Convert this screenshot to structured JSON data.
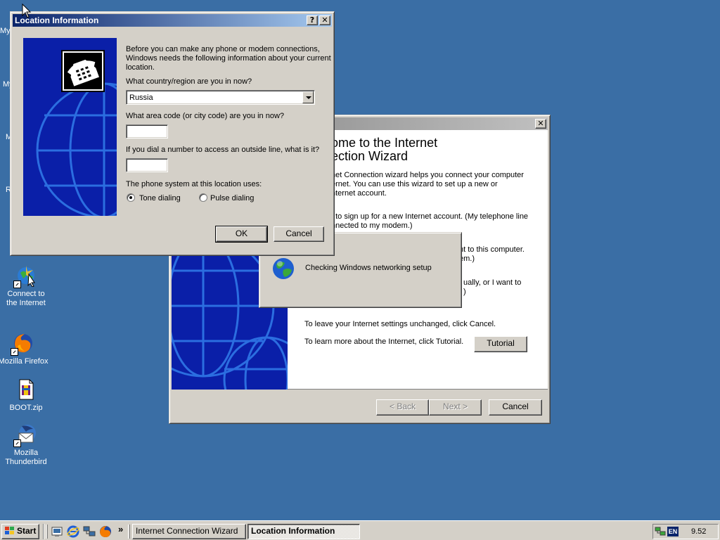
{
  "desktop": {
    "partial_labels": [
      "My",
      "My",
      "M",
      "R"
    ],
    "icons": [
      {
        "label_line1": "Connect to",
        "label_line2": "the Internet",
        "icon": "connect-internet-icon"
      },
      {
        "label_line1": "Mozilla Firefox",
        "label_line2": "",
        "icon": "firefox-icon"
      },
      {
        "label_line1": "BOOT.zip",
        "label_line2": "",
        "icon": "zip-file-icon"
      },
      {
        "label_line1": "Mozilla",
        "label_line2": "Thunderbird",
        "icon": "thunderbird-icon"
      }
    ]
  },
  "wizard": {
    "title": "",
    "heading_line1": "ome to the Internet",
    "heading_line2": "ection Wizard",
    "p1_line1": "net Connection wizard helps you connect your computer",
    "p1_line2": "ernet.  You can use this wizard to set up a new or",
    "p1_line3": "nternet account.",
    "p2_line1": "t to sign up for a new Internet account. (My telephone line",
    "p2_line2": "nnected to my modem.)",
    "p3_line1": "nt to this computer.",
    "p3_line2": "em.)",
    "p4_line1": "ually, or I want to",
    "p4_line2": ")",
    "leave_text": "To leave your Internet settings unchanged, click Cancel.",
    "learn_text": "To learn more about the Internet, click Tutorial.",
    "tutorial_label": "Tutorial",
    "back_label": "< Back",
    "next_label": "Next >",
    "cancel_label": "Cancel",
    "close_glyph": "✕"
  },
  "checking_popup": {
    "message": "Checking Windows networking setup"
  },
  "location_dialog": {
    "title": "Location Information",
    "help_glyph": "?",
    "close_glyph": "✕",
    "intro_line1": "Before you can make any phone or modem connections,",
    "intro_line2": "Windows needs the following information about your current",
    "intro_line3": "location.",
    "country_question": "What country/region are you in now?",
    "country_value": "Russia",
    "area_question": "What area code (or city code) are you in now?",
    "area_value": "",
    "outside_question": "If you dial a number to access an outside line, what is it?",
    "outside_value": "",
    "phone_system_label": "The phone system at this location uses:",
    "tone_label": "Tone dialing",
    "pulse_label": "Pulse dialing",
    "tone_selected": true,
    "ok_label": "OK",
    "cancel_label": "Cancel"
  },
  "taskbar": {
    "start_label": "Start",
    "quicklaunch": [
      "show-desktop-icon",
      "internet-explorer-icon",
      "network-icon",
      "firefox-icon"
    ],
    "chevron": "»",
    "tasks": [
      {
        "label": "Internet Connection Wizard",
        "active": false
      },
      {
        "label": "Location Information",
        "active": true
      }
    ],
    "lang": "EN",
    "clock": "9.52"
  }
}
